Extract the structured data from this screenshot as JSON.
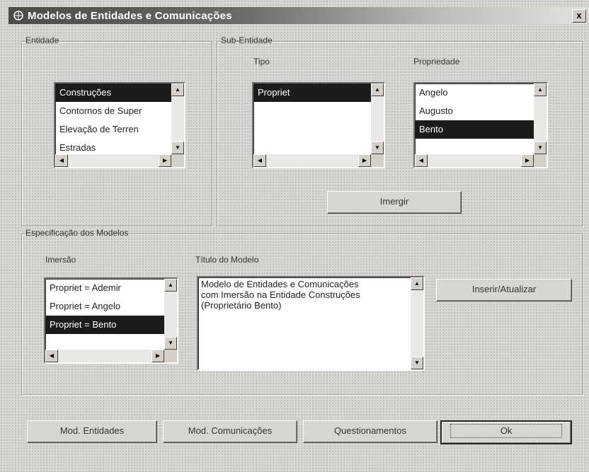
{
  "window": {
    "title": "Modelos de Entidades e Comunicações",
    "close_label": "x"
  },
  "entidade": {
    "group_label": "Entidade",
    "items": [
      "Construções",
      "Contornos de Super",
      "Elevação de Terren",
      "Estradas"
    ]
  },
  "sub_entidade": {
    "group_label": "Sub-Entidade",
    "tipo_label": "Tipo",
    "tipo_items": [
      "Propriet"
    ],
    "propriedade_label": "Propriedade",
    "propriedade_items": [
      "Angelo",
      "Augusto",
      "Bento"
    ],
    "imergir_label": "Imergir"
  },
  "especificacao": {
    "group_label": "Especificação dos Modelos",
    "imersao_label": "Imersão",
    "imersao_items": [
      "Propriet = Ademir",
      "Propriet = Angelo",
      "Propriet = Bento"
    ],
    "titulo_label": "Título do Modelo",
    "titulo_text": "Modelo de Entidades e Comunicações\ncom Imersão na Entidade Construções\n(Proprietário Bento)",
    "inserir_label": "Inserir/Atualizar"
  },
  "footer": {
    "mod_entidades": "Mod. Entidades",
    "mod_comunicacoes": "Mod. Comunicações",
    "questionamentos": "Questionamentos",
    "ok": "Ok"
  },
  "selection": {
    "entidade": 0,
    "tipo": 0,
    "propriedade": 2,
    "imersao": 2
  },
  "colors": {
    "selection_bg": "#1c1c1c",
    "dialog_bg": "#d4d4d0"
  }
}
